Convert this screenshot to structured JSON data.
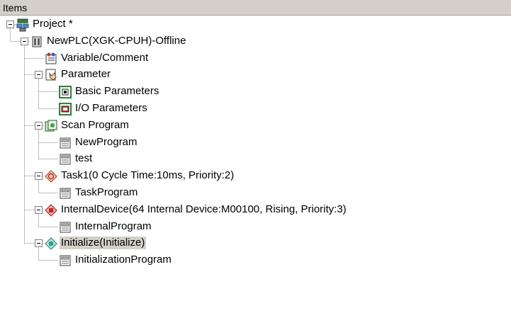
{
  "header": {
    "title": "Items"
  },
  "tree": [
    {
      "label": "Project *",
      "depth": 0,
      "expandable": true,
      "icon": "project-icon"
    },
    {
      "label": "NewPLC(XGK-CPUH)-Offline",
      "depth": 1,
      "expandable": true,
      "icon": "plc-icon"
    },
    {
      "label": "Variable/Comment",
      "depth": 2,
      "expandable": false,
      "icon": "variable-comment-icon"
    },
    {
      "label": "Parameter",
      "depth": 2,
      "expandable": true,
      "icon": "parameter-icon"
    },
    {
      "label": "Basic Parameters",
      "depth": 3,
      "expandable": false,
      "icon": "basic-parameters-icon"
    },
    {
      "label": "I/O Parameters",
      "depth": 3,
      "expandable": false,
      "icon": "io-parameters-icon"
    },
    {
      "label": "Scan Program",
      "depth": 2,
      "expandable": true,
      "icon": "scan-program-icon"
    },
    {
      "label": "NewProgram",
      "depth": 3,
      "expandable": false,
      "icon": "program-icon"
    },
    {
      "label": "test",
      "depth": 3,
      "expandable": false,
      "icon": "program-icon"
    },
    {
      "label": "Task1(0 Cycle Time:10ms, Priority:2)",
      "depth": 2,
      "expandable": true,
      "icon": "cyclic-task-icon"
    },
    {
      "label": "TaskProgram",
      "depth": 3,
      "expandable": false,
      "icon": "program-icon"
    },
    {
      "label": "InternalDevice(64 Internal Device:M00100, Rising, Priority:3)",
      "depth": 2,
      "expandable": true,
      "icon": "internal-device-task-icon"
    },
    {
      "label": "InternalProgram",
      "depth": 3,
      "expandable": false,
      "icon": "program-icon"
    },
    {
      "label": "Initialize(Initialize)",
      "depth": 2,
      "expandable": true,
      "icon": "initialize-task-icon",
      "selected": true
    },
    {
      "label": "InitializationProgram",
      "depth": 3,
      "expandable": false,
      "icon": "program-icon"
    }
  ]
}
